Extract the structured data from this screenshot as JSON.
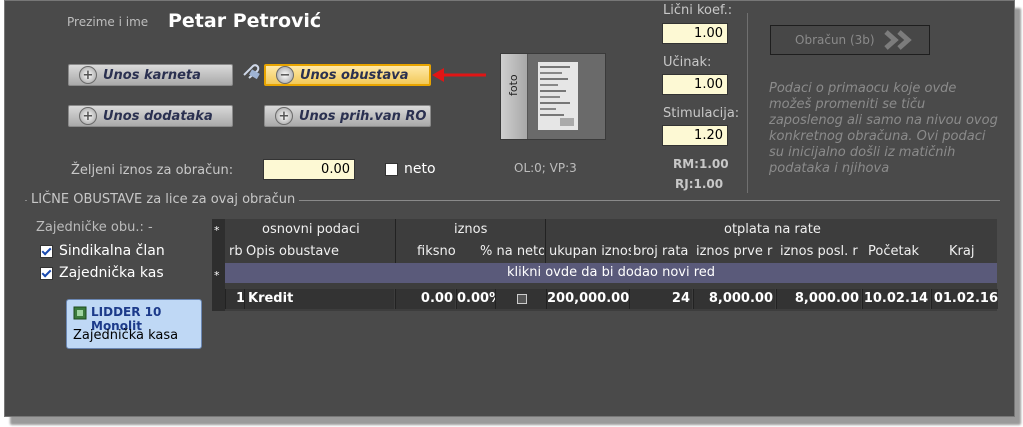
{
  "header": {
    "name_label": "Prezime i ime",
    "name_value": "Petar Petrović"
  },
  "buttons": {
    "unos_karneta": "Unos karneta",
    "unos_obustava": "Unos obustava",
    "unos_dodataka": "Unos dodataka",
    "unos_prih": "Unos prih.van RO"
  },
  "zeljeni": {
    "label": "Željeni iznos za obračun:",
    "value": "0.00",
    "neto_label": "neto"
  },
  "photo": {
    "tab_label": "foto",
    "status": "OL:0;  VP:3"
  },
  "koef": {
    "licni_label": "Lični koef.:",
    "licni_value": "1.00",
    "ucinak_label": "Učinak:",
    "ucinak_value": "1.00",
    "stim_label": "Stimulacija:",
    "stim_value": "1.20",
    "rm": "RM:1.00",
    "rj": "RJ:1.00"
  },
  "obracun": {
    "label": "Obračun (3b)",
    "info": "Podaci o primaocu koje ovde možeš promeniti se tiču zaposlenog ali samo na nivou ovog konkretnog obračuna. Ovi podaci su inicijalno došli iz matičnih podataka i njihova"
  },
  "section": {
    "title": "LIČNE OBUSTAVE za lice za ovaj obračun",
    "sub_title": "Zajedničke obu.: -",
    "checks": [
      {
        "label": "Sindikalna član",
        "checked": true
      },
      {
        "label": "Zajednička kas",
        "checked": true
      }
    ]
  },
  "tooltip": {
    "title": "LIDDER 10 Monolit",
    "text": "Zajednička kasa"
  },
  "grid": {
    "groups": {
      "osnovni": "osnovni podaci",
      "iznos": "iznos",
      "otplata": "otplata na rate"
    },
    "columns": [
      "rb",
      "Opis obustave",
      "fiksno",
      "% na neto",
      "ukupan iznos",
      "broj rata",
      "iznos prve r",
      "iznos posl. r",
      "Početak",
      "Kraj"
    ],
    "add_row": "klikni ovde da bi dodao novi red",
    "rows": [
      {
        "rb": "1",
        "opis": "Kredit",
        "fiksno": "0.00",
        "procenat": "0.00%",
        "ukupan": "200,000.00",
        "broj_rata": "24",
        "prva": "8,000.00",
        "posl": "8,000.00",
        "pocetak": "10.02.14",
        "kraj": "01.02.16"
      }
    ]
  }
}
